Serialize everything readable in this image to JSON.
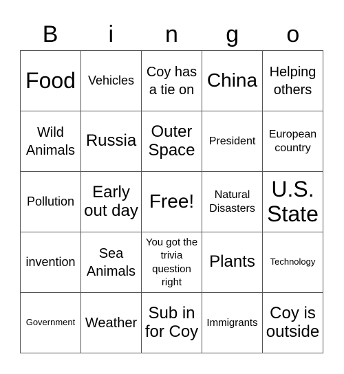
{
  "title_letters": [
    "B",
    "i",
    "n",
    "g",
    "o"
  ],
  "cells": [
    {
      "text": "Food",
      "size": "s-xl"
    },
    {
      "text": "Vehicles",
      "size": "s-sm"
    },
    {
      "text": "Coy has a tie on",
      "size": "s-n"
    },
    {
      "text": "China",
      "size": "s-l"
    },
    {
      "text": "Helping others",
      "size": "s-n"
    },
    {
      "text": "Wild Animals",
      "size": "s-n"
    },
    {
      "text": "Russia",
      "size": "s-m"
    },
    {
      "text": "Outer Space",
      "size": "s-m"
    },
    {
      "text": "President",
      "size": "s-s"
    },
    {
      "text": "European country",
      "size": "s-s"
    },
    {
      "text": "Pollution",
      "size": "s-sm"
    },
    {
      "text": "Early out day",
      "size": "s-m"
    },
    {
      "text": "Free!",
      "size": "s-l"
    },
    {
      "text": "Natural Disasters",
      "size": "s-s"
    },
    {
      "text": "U.S. State",
      "size": "s-xl"
    },
    {
      "text": "invention",
      "size": "s-sm"
    },
    {
      "text": "Sea Animals",
      "size": "s-n"
    },
    {
      "text": "You got the trivia question right",
      "size": "s-xs"
    },
    {
      "text": "Plants",
      "size": "s-m"
    },
    {
      "text": "Technology",
      "size": "s-xxs"
    },
    {
      "text": "Government",
      "size": "s-xxs"
    },
    {
      "text": "Weather",
      "size": "s-n"
    },
    {
      "text": "Sub in for Coy",
      "size": "s-m"
    },
    {
      "text": "Immigrants",
      "size": "s-xs"
    },
    {
      "text": "Coy is outside",
      "size": "s-m"
    }
  ]
}
